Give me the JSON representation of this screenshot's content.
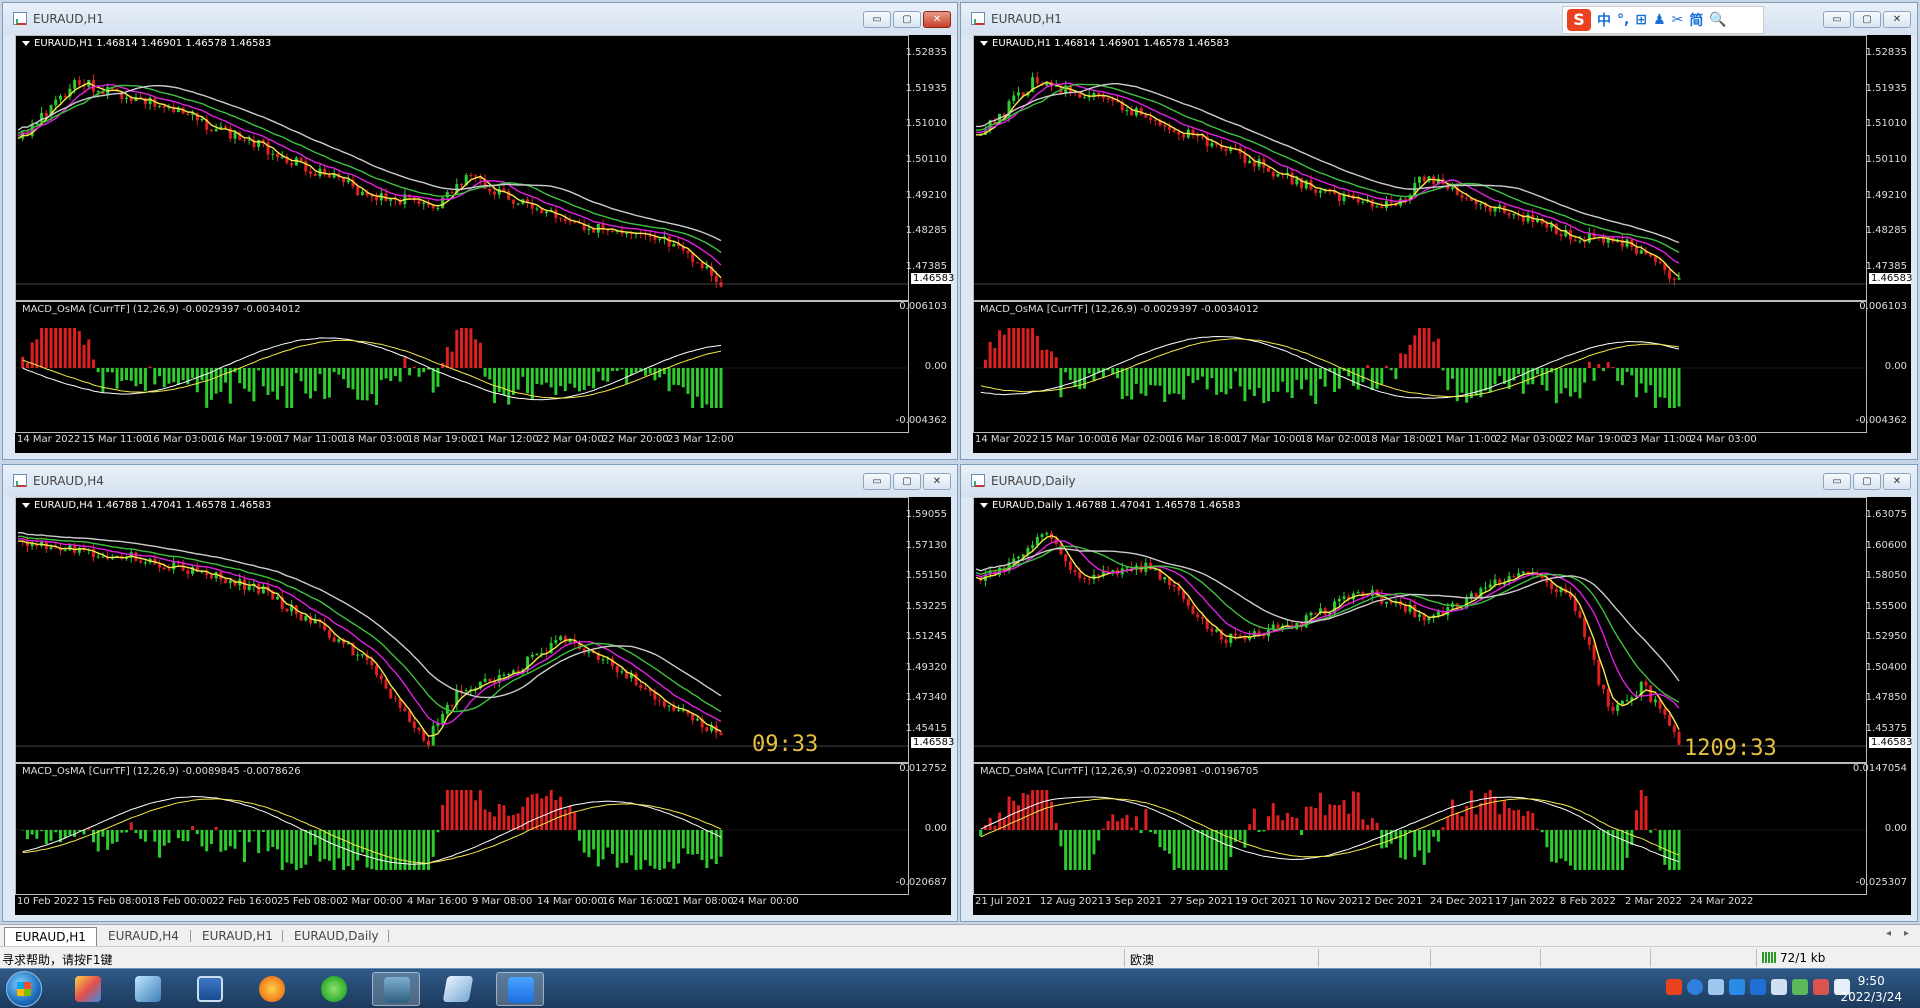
{
  "windows": [
    {
      "id": "w1",
      "title": "EURAUD,H1",
      "info": "EURAUD,H1  1.46814 1.46901 1.46578 1.46583",
      "price_ticks": [
        "1.52835",
        "1.51935",
        "1.51010",
        "1.50110",
        "1.49210",
        "1.48285",
        "1.47385"
      ],
      "current_price": "1.46583",
      "indicator": "MACD_OsMA [CurrTF] (12,26,9) -0.0029397 -0.0034012",
      "ind_ticks": [
        "0.006103",
        "0.00",
        "-0.004362"
      ],
      "time_labels": [
        "14 Mar 2022",
        "15 Mar 11:00",
        "16 Mar 03:00",
        "16 Mar 19:00",
        "17 Mar 11:00",
        "18 Mar 03:00",
        "18 Mar 19:00",
        "21 Mar 12:00",
        "22 Mar 04:00",
        "22 Mar 20:00",
        "23 Mar 12:00"
      ],
      "clock": ""
    },
    {
      "id": "w2",
      "title": "EURAUD,H1",
      "info": "EURAUD,H1  1.46814 1.46901 1.46578 1.46583",
      "price_ticks": [
        "1.52835",
        "1.51935",
        "1.51010",
        "1.50110",
        "1.49210",
        "1.48285",
        "1.47385"
      ],
      "current_price": "1.46583",
      "indicator": "MACD_OsMA [CurrTF] (12,26,9) -0.0029397 -0.0034012",
      "ind_ticks": [
        "0.006103",
        "0.00",
        "-0.004362"
      ],
      "time_labels": [
        "14 Mar 2022",
        "15 Mar 10:00",
        "16 Mar 02:00",
        "16 Mar 18:00",
        "17 Mar 10:00",
        "18 Mar 02:00",
        "18 Mar 18:00",
        "21 Mar 11:00",
        "22 Mar 03:00",
        "22 Mar 19:00",
        "23 Mar 11:00",
        "24 Mar 03:00"
      ],
      "clock": ""
    },
    {
      "id": "w3",
      "title": "EURAUD,H4",
      "info": "EURAUD,H4  1.46788 1.47041 1.46578 1.46583",
      "price_ticks": [
        "1.59055",
        "1.57130",
        "1.55150",
        "1.53225",
        "1.51245",
        "1.49320",
        "1.47340",
        "1.45415"
      ],
      "current_price": "1.46583",
      "indicator": "MACD_OsMA [CurrTF] (12,26,9) -0.0089845 -0.0078626",
      "ind_ticks": [
        "0.012752",
        "0.00",
        "-0.020687"
      ],
      "time_labels": [
        "10 Feb 2022",
        "15 Feb 08:00",
        "18 Feb 00:00",
        "22 Feb 16:00",
        "25 Feb 08:00",
        "2 Mar 00:00",
        "4 Mar 16:00",
        "9 Mar 08:00",
        "14 Mar 00:00",
        "16 Mar 16:00",
        "21 Mar 08:00",
        "24 Mar 00:00"
      ],
      "clock": "09:33"
    },
    {
      "id": "w4",
      "title": "EURAUD,Daily",
      "info": "EURAUD,Daily  1.46788 1.47041 1.46578 1.46583",
      "price_ticks": [
        "1.63075",
        "1.60600",
        "1.58050",
        "1.55500",
        "1.52950",
        "1.50400",
        "1.47850",
        "1.45375"
      ],
      "current_price": "1.46583",
      "indicator": "MACD_OsMA [CurrTF] (12,26,9) -0.0220981 -0.0196705",
      "ind_ticks": [
        "0.0147054",
        "0.00",
        "-0.025307"
      ],
      "time_labels": [
        "21 Jul 2021",
        "12 Aug 2021",
        "3 Sep 2021",
        "27 Sep 2021",
        "19 Oct 2021",
        "10 Nov 2021",
        "2 Dec 2021",
        "24 Dec 2021",
        "17 Jan 2022",
        "8 Feb 2022",
        "2 Mar 2022",
        "24 Mar 2022"
      ],
      "clock": "1209:33"
    }
  ],
  "tabs": [
    "EURAUD,H1",
    "EURAUD,H4",
    "EURAUD,H1",
    "EURAUD,Daily"
  ],
  "status": {
    "help": "寻求帮助，请按F1键",
    "profile": "欧澳",
    "traffic": "72/1 kb"
  },
  "ime": {
    "logo": "S",
    "glyphs": [
      "中",
      "°,",
      "⊞",
      "♟",
      "✂",
      "简",
      "🔍"
    ]
  },
  "taskbar": {
    "time": "9:50",
    "date": "2022/3/24"
  },
  "colors": {
    "bull": "#2ecc2e",
    "bear": "#e02020",
    "ma_yellow": "#f5e94a",
    "ma_magenta": "#e020e0",
    "ma_green": "#40c040",
    "ma_gray": "#cccccc"
  }
}
